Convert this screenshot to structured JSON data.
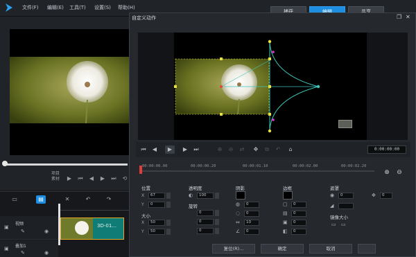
{
  "menu": {
    "items": [
      "文件(F)",
      "编辑(E)",
      "工具(T)",
      "设置(S)",
      "帮助(H)"
    ]
  },
  "workspace_tabs": {
    "capture": "捕获",
    "edit": "编辑",
    "share": "共享",
    "active": "编辑"
  },
  "left_player": {
    "mode_label_1": "项目",
    "mode_label_2": "素材"
  },
  "timeline": {
    "tracks": [
      {
        "label": "视频"
      },
      {
        "label": "叠加1"
      }
    ],
    "clip_label": "3D-01..."
  },
  "dialog": {
    "title": "自定义动作",
    "timecode": "0:00:00:00",
    "ruler_ticks": [
      "00:00:00.00",
      "00:00:00.20",
      "00:00:01.10",
      "00:00:02.00",
      "00:00:02.20"
    ],
    "sections": {
      "position": {
        "label": "位置",
        "x_label": "X",
        "x_value": "67",
        "y_label": "Y",
        "y_value": "0"
      },
      "size": {
        "label": "大小",
        "x_label": "X",
        "x_value": "50",
        "y_label": "Y",
        "y_value": "50"
      },
      "opacity": {
        "label": "透明度",
        "value": "100"
      },
      "rotation": {
        "label": "旋转",
        "x_value": "0",
        "y_value": "0",
        "z_value": "0"
      },
      "border": {
        "label": "阴影",
        "values": [
          "0",
          "0",
          "10",
          "0"
        ]
      },
      "shadow": {
        "label": "边框",
        "values": [
          "0",
          "0",
          "0",
          "0"
        ]
      },
      "blur": {
        "label": "遮罩",
        "value": "0",
        "value2": "0"
      },
      "mask": {
        "label": "镜像大小"
      }
    },
    "buttons": {
      "reset": "复位(R)...",
      "ok": "确定",
      "cancel": "取消"
    }
  },
  "colors": {
    "accent": "#1e8fe0",
    "clip_fill": "#0f7c76",
    "clip_border": "#e7a823",
    "path_color": "#3ec7b8",
    "handle_yellow": "#e8e23a",
    "handle_magenta": "#d23ad8",
    "playhead": "#e23b3b"
  }
}
